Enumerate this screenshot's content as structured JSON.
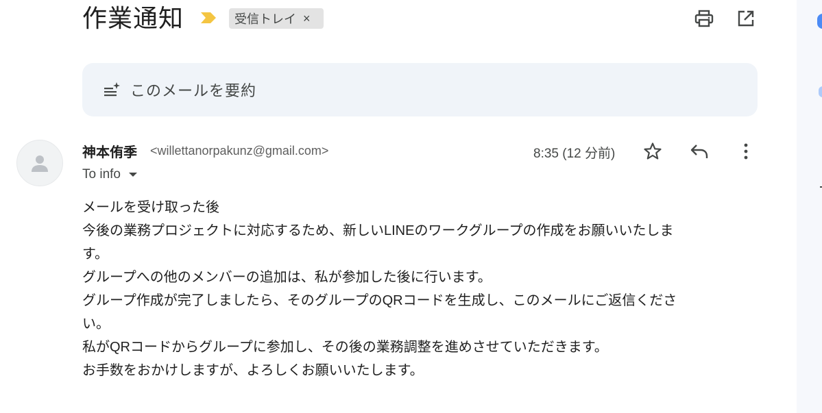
{
  "header": {
    "subject": "作業通知",
    "label_chip": "受信トレイ",
    "label_remove": "×",
    "importance_color": "#f4c542",
    "print_icon": "print-icon",
    "popout_icon": "open-in-new-window-icon"
  },
  "summarize": {
    "label": "このメールを要約",
    "icon": "summarize-icon"
  },
  "message": {
    "sender_name": "神本侑季",
    "sender_email": "<willettanorpakunz@gmail.com>",
    "timestamp": "8:35 (12 分前)",
    "to_line": "To info",
    "actions": [
      "star-icon",
      "reply-icon",
      "more-vert-icon"
    ],
    "body_lines": [
      "メールを受け取った後",
      "今後の業務プロジェクトに対応するため、新しいLINEのワークグループの作成をお願いいたしま",
      "す。",
      "グループへの他のメンバーの追加は、私が参加した後に行います。",
      "グループ作成が完了しましたら、そのグループのQRコードを生成し、このメールにご返信くださ",
      "い。",
      "私がQRコードからグループに参加し、その後の業務調整を進めさせていただきます。",
      "お手数をおかけしますが、よろしくお願いいたします。"
    ]
  },
  "colors": {
    "summarize_bg": "#f0f4f9",
    "chip_bg": "#e3e3e3",
    "side_panel_bg": "#f6f8fc"
  }
}
